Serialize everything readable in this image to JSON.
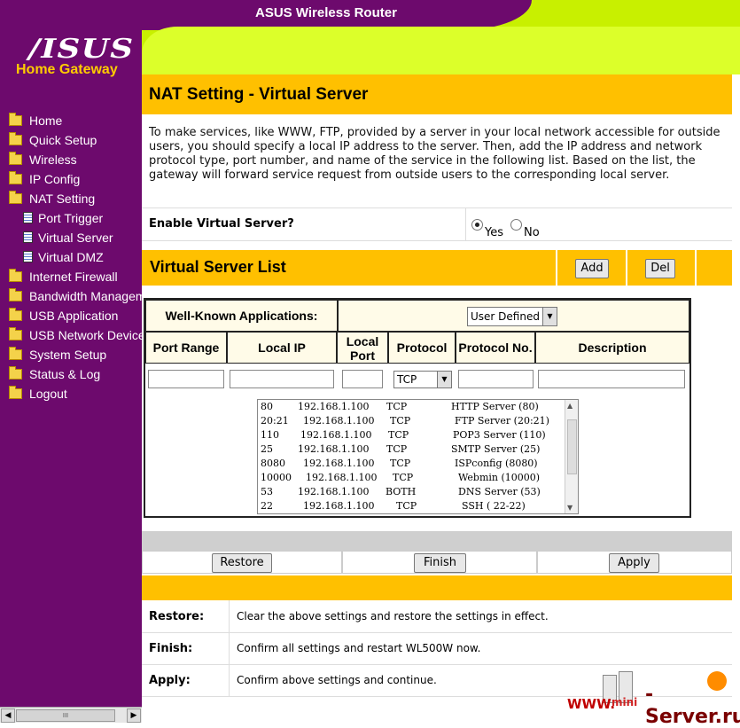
{
  "header": {
    "title": "ASUS Wireless Router"
  },
  "sidebar": {
    "logo": "/ISUS",
    "logo_sub": "Home Gateway",
    "items": [
      {
        "label": "Home"
      },
      {
        "label": "Quick Setup"
      },
      {
        "label": "Wireless"
      },
      {
        "label": "IP Config"
      },
      {
        "label": "NAT Setting"
      },
      {
        "label": "Port Trigger"
      },
      {
        "label": "Virtual Server"
      },
      {
        "label": "Virtual DMZ"
      },
      {
        "label": "Internet Firewall"
      },
      {
        "label": "Bandwidth Manageme"
      },
      {
        "label": "USB Application"
      },
      {
        "label": "USB Network Devices"
      },
      {
        "label": "System Setup"
      },
      {
        "label": "Status & Log"
      },
      {
        "label": "Logout"
      }
    ],
    "scroll_thumb": "III"
  },
  "main": {
    "title": "NAT Setting - Virtual Server",
    "description": "To make services, like WWW, FTP, provided by a server in your local network accessible for outside users, you should specify a local IP address to the server. Then, add the IP address and network protocol type, port number, and name of the service in the following list. Based on the list, the gateway will forward service request from outside users to the corresponding local server.",
    "enable": {
      "label": "Enable Virtual Server?",
      "yes": "Yes",
      "no": "No",
      "selected": "Yes"
    },
    "list": {
      "title": "Virtual Server List",
      "add": "Add",
      "del": "Del",
      "well_known_label": "Well-Known Applications:",
      "well_known_value": "User Defined",
      "columns": [
        "Port Range",
        "Local IP",
        "Local Port",
        "Protocol",
        "Protocol No.",
        "Description"
      ],
      "protocol_value": "TCP",
      "entries": [
        [
          "80",
          "192.168.1.100",
          "TCP",
          "HTTP Server (80)"
        ],
        [
          "20:21",
          "192.168.1.100",
          "TCP",
          "FTP Server (20:21)"
        ],
        [
          "110",
          "192.168.1.100",
          "TCP",
          "POP3 Server (110)"
        ],
        [
          "25",
          "192.168.1.100",
          "TCP",
          "SMTP Server (25)"
        ],
        [
          "8080",
          "192.168.1.100",
          "TCP",
          "ISPconfig (8080)"
        ],
        [
          "10000",
          "192.168.1.100",
          "TCP",
          "Webmin (10000)"
        ],
        [
          "53",
          "192.168.1.100",
          "BOTH",
          "DNS Server (53)"
        ],
        [
          "22",
          "192.168.1.100",
          "TCP",
          "SSH ( 22-22)"
        ]
      ]
    },
    "actions": {
      "restore": "Restore",
      "finish": "Finish",
      "apply": "Apply"
    },
    "help": [
      {
        "key": "Restore:",
        "text": "Clear the above settings and restore the settings in effect."
      },
      {
        "key": "Finish:",
        "text": "Confirm all settings and restart WL500W now."
      },
      {
        "key": "Apply:",
        "text": "Confirm above settings and continue."
      }
    ]
  },
  "watermark": {
    "www": "WWW.",
    "mini": "mini",
    "server": "-Server.ru"
  },
  "colors": {
    "sidebar": "#6d0a6d",
    "header_green": "#c8f000",
    "bar_yellow": "#ffc000",
    "logo_sub": "#ffcc00"
  }
}
